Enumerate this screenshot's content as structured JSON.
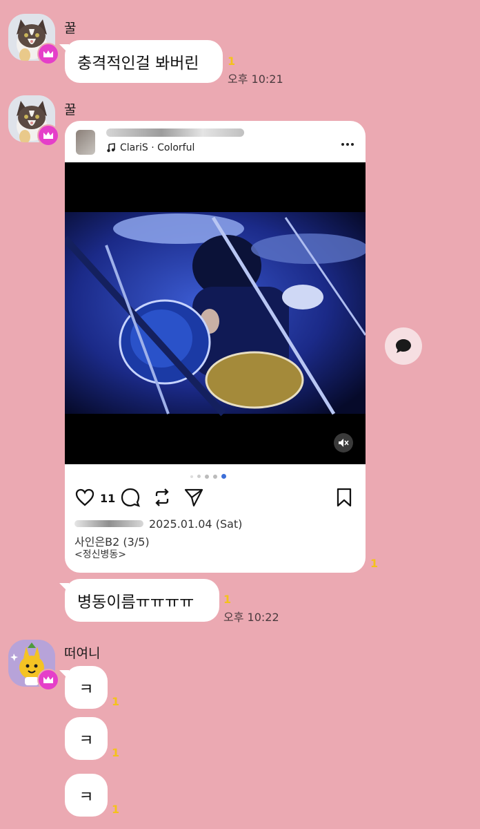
{
  "colors": {
    "background": "#eba9b2",
    "bubble": "#ffffff",
    "unread": "#f4c21b",
    "crown": "#e53fc9"
  },
  "messages": {
    "m1": {
      "sender": "꿀",
      "text": "충격적인걸 봐버린",
      "unread": "1",
      "time": "오후 10:21"
    },
    "m2": {
      "sender": "꿀",
      "unread": "1"
    },
    "m3": {
      "text": "병동이름ㅠㅠㅠㅠ",
      "unread": "1",
      "time": "오후 10:22"
    },
    "m4": {
      "sender": "떠여니",
      "bubbles": [
        "ㅋ",
        "ㅋ",
        "ㅋ"
      ],
      "unread": [
        "1",
        "1",
        "1"
      ]
    }
  },
  "post": {
    "music": "ClariS · Colorful",
    "likes": "11",
    "date": "2025.01.04 (Sat)",
    "caption_line1": "사인은B2 (3/5)",
    "caption_line2": "<정신병동>",
    "icons": [
      "music-note-icon",
      "more-icon",
      "mute-icon",
      "heart-icon",
      "comment-icon",
      "repost-icon",
      "share-icon",
      "bookmark-icon"
    ]
  }
}
